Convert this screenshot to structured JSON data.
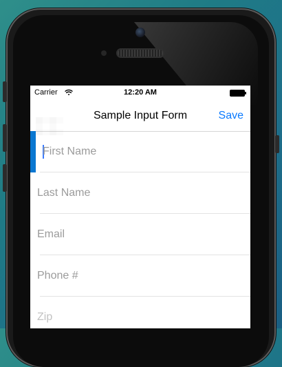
{
  "status_bar": {
    "carrier": "Carrier",
    "time": "12:20 AM"
  },
  "nav": {
    "title": "Sample Input Form",
    "save_label": "Save"
  },
  "form": {
    "fields": [
      {
        "placeholder": "First Name",
        "active": true
      },
      {
        "placeholder": "Last Name",
        "active": false
      },
      {
        "placeholder": "Email",
        "active": false
      },
      {
        "placeholder": "Phone #",
        "active": false
      },
      {
        "placeholder": "Zip",
        "active": false
      }
    ]
  },
  "colors": {
    "accent": "#0a7aff",
    "active_field_bar": "#0a77d1",
    "placeholder": "#9b9b9b"
  },
  "icons": {
    "wifi": "wifi-icon",
    "battery": "battery-icon"
  }
}
